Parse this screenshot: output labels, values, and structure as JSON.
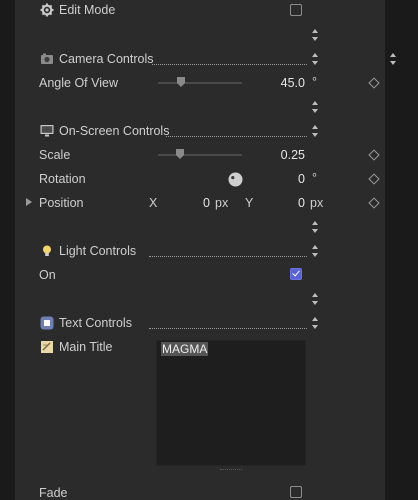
{
  "edit_mode": {
    "label": "Edit Mode",
    "checked": false
  },
  "camera_controls": {
    "title": "Camera Controls",
    "angle_of_view": {
      "label": "Angle Of View",
      "value": "45.0",
      "unit": "°"
    }
  },
  "onscreen_controls": {
    "title": "On-Screen Controls",
    "scale": {
      "label": "Scale",
      "value": "0.25"
    },
    "rotation": {
      "label": "Rotation",
      "value": "0",
      "unit": "°"
    },
    "position": {
      "label": "Position",
      "x_label": "X",
      "x_value": "0",
      "x_unit": "px",
      "y_label": "Y",
      "y_value": "0",
      "y_unit": "px"
    }
  },
  "light_controls": {
    "title": "Light Controls",
    "on": {
      "label": "On",
      "checked": true
    }
  },
  "text_controls": {
    "title": "Text Controls",
    "main_title": {
      "label": "Main Title",
      "value": "MAGMA"
    }
  },
  "fade": {
    "label": "Fade",
    "checked": false
  }
}
